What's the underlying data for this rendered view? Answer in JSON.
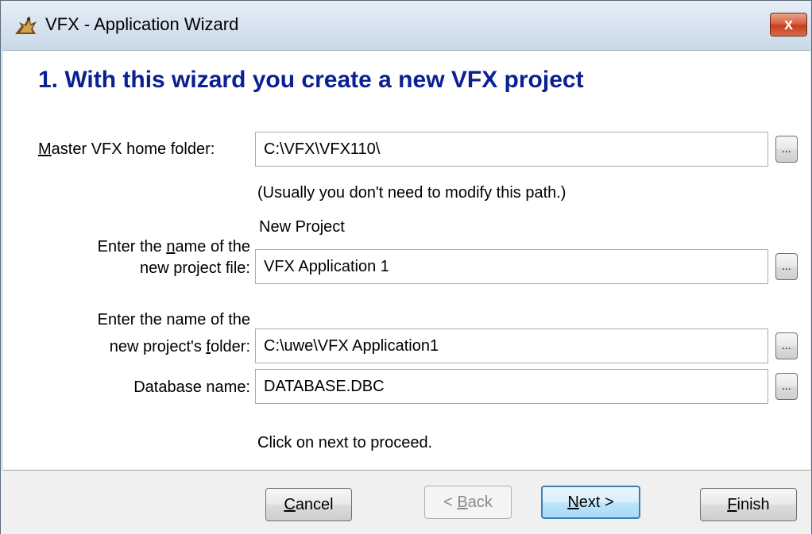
{
  "window": {
    "title": "VFX - Application Wizard",
    "close_glyph": "x"
  },
  "wizard": {
    "heading": "1. With this wizard you create a new VFX project",
    "master_folder": {
      "label_prefix": "",
      "label_mnemonic": "M",
      "label_rest": "aster VFX home folder:",
      "value": "C:\\VFX\\VFX110\\",
      "hint": "(Usually you don't need to modify this path.)"
    },
    "project_file": {
      "caption": "New Project",
      "label_line1_prefix": "Enter the ",
      "label_line1_mnemonic": "n",
      "label_line1_rest": "ame of the",
      "label_line2": "new project file:",
      "value": "VFX Application 1"
    },
    "project_folder": {
      "label_line1": "Enter the name of the",
      "label_line2_prefix": "new project's ",
      "label_line2_mnemonic": "f",
      "label_line2_rest": "older:",
      "value": "C:\\uwe\\VFX Application1"
    },
    "database": {
      "label": "Database name:",
      "value": "DATABASE.DBC"
    },
    "instruction": "Click on next to proceed.",
    "browse_label": "..."
  },
  "buttons": {
    "cancel": {
      "mnemonic": "C",
      "rest": "ancel"
    },
    "back": {
      "prefix": "< ",
      "mnemonic": "B",
      "rest": "ack"
    },
    "next": {
      "mnemonic": "N",
      "rest": "ext >"
    },
    "finish": {
      "mnemonic": "F",
      "rest": "inish"
    }
  },
  "colors": {
    "heading": "#0b2093",
    "title_bar": "#d7e3ef",
    "close_button": "#c6401e",
    "focus_border": "#3c7fb1"
  }
}
